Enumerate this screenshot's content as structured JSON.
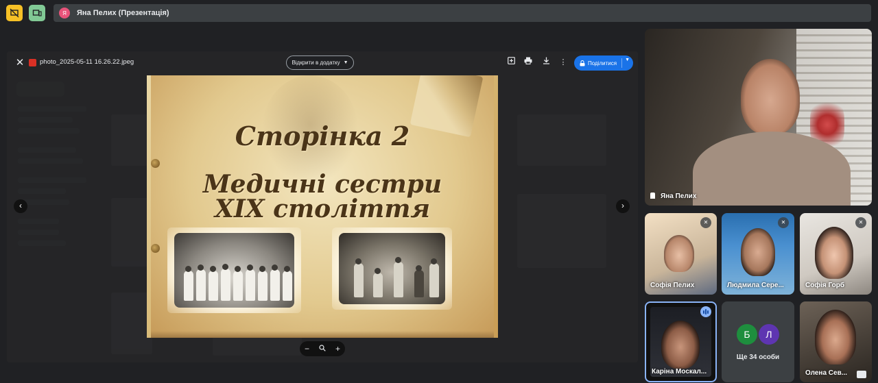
{
  "topbar": {
    "presenter_initial": "Я",
    "presenter_label": "Яна Пелих (Презентація)"
  },
  "viewer": {
    "filename": "photo_2025-05-11 16.26.22.jpeg",
    "open_with": "Відкрити в додатку",
    "share": "Поділитися",
    "zoom_out": "−",
    "zoom_in": "+"
  },
  "slide": {
    "heading": "Сторінка 2",
    "title_line1": "Медичні сестри",
    "title_line2": "XIX століття"
  },
  "participants": {
    "main": {
      "name": "Яна Пелих"
    },
    "grid": [
      {
        "name": "Софія Пелих"
      },
      {
        "name": "Людмила Сере..."
      },
      {
        "name": "Софія Горб"
      },
      {
        "name": "Каріна Москал..."
      },
      {
        "name": "Олена Сев..."
      }
    ],
    "more": {
      "avatar1": "Б",
      "avatar2": "Л",
      "label": "Ще 34 особи"
    }
  },
  "colors": {
    "share_button": "#1a73e8",
    "avatar_b": "#1e8e3e",
    "avatar_l": "#5e35b1",
    "speaking_indicator": "#8ab4f8"
  }
}
